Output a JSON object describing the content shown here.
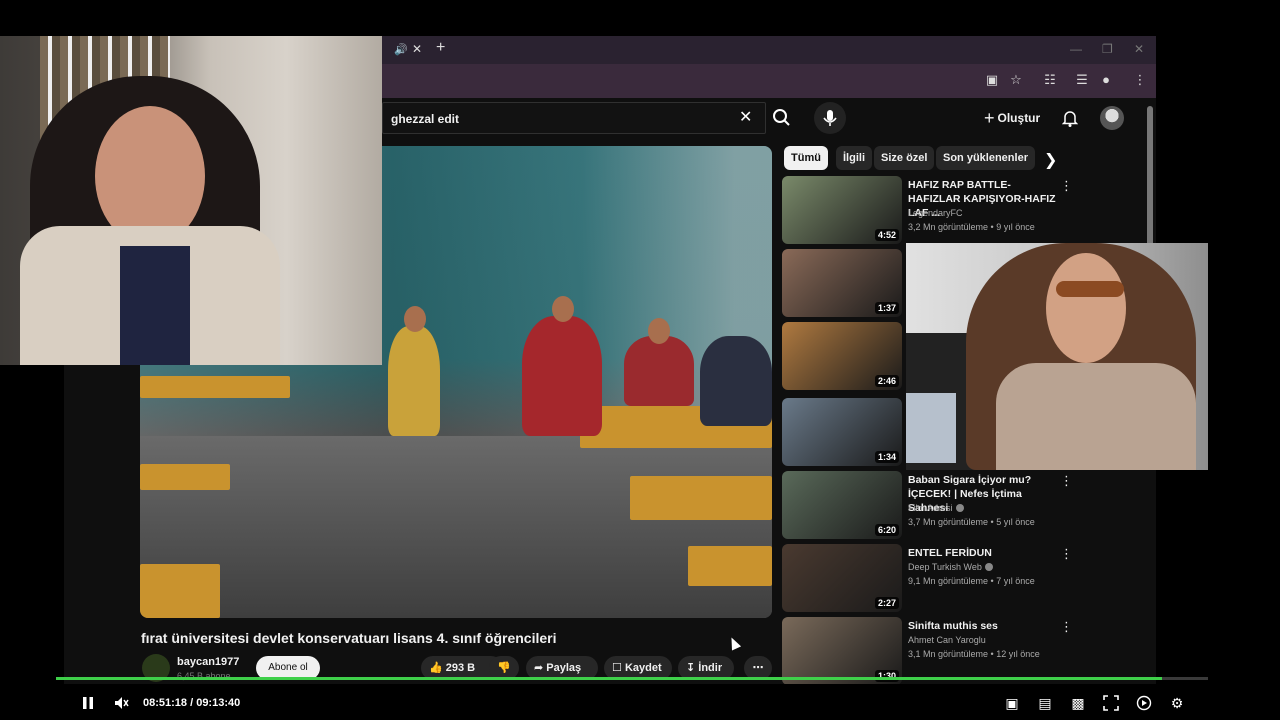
{
  "browser": {
    "tab_audio_icon": "speaker-icon",
    "new_tab_label": "+"
  },
  "header": {
    "search_value": "ghezzal edit",
    "create_label": "Oluştur"
  },
  "chips": [
    "Tümü",
    "İlgili",
    "Size özel",
    "Son yüklenenler"
  ],
  "video": {
    "title": "fırat üniversitesi devlet konservatuarı lisans 4. sınıf öğrencileri",
    "channel": "baycan1977",
    "subscribers": "6,45 B abone",
    "subscribe_label": "Abone ol",
    "likes": "293 B",
    "share_label": "Paylaş",
    "save_label": "Kaydet",
    "download_label": "İndir"
  },
  "recommendations": [
    {
      "title": "HAFIZ RAP BATTLE-HAFIZLAR KAPIŞIYOR-HAFIZ LAF ...",
      "channel": "LegendaryFC",
      "meta": "3,2 Mn görüntüleme • 9 yıl önce",
      "duration": "4:52",
      "verified": false
    },
    {
      "title": "",
      "channel": "",
      "meta": "",
      "duration": "1:37",
      "verified": false
    },
    {
      "title": "",
      "channel": "",
      "meta": "",
      "duration": "2:46",
      "verified": false
    },
    {
      "title": "",
      "channel": "",
      "meta": "",
      "duration": "1:34",
      "verified": false
    },
    {
      "title": "Baban Sigara İçiyor mu? İÇECEK! | Nefes İçtima Sahnesi",
      "channel": "Film Adresi",
      "meta": "3,7 Mn görüntüleme • 5 yıl önce",
      "duration": "6:20",
      "verified": true
    },
    {
      "title": "ENTEL FERİDUN",
      "channel": "Deep Turkish Web",
      "meta": "9,1 Mn görüntüleme • 7 yıl önce",
      "duration": "2:27",
      "verified": true
    },
    {
      "title": "Sinifta muthis ses",
      "channel": "Ahmet Can Yaroglu",
      "meta": "3,1 Mn görüntüleme • 12 yıl önce",
      "duration": "1:30",
      "verified": false
    }
  ],
  "thumb_colors": [
    "#7a8a6a",
    "#8a6a58",
    "#b07a40",
    "#6a7a8a",
    "#5a6a5a",
    "#4a3a30",
    "#7a6a5a"
  ],
  "stream": {
    "time": "08:51:18 / 09:13:40",
    "progress": 0.96,
    "accent": "#3fd04a"
  }
}
